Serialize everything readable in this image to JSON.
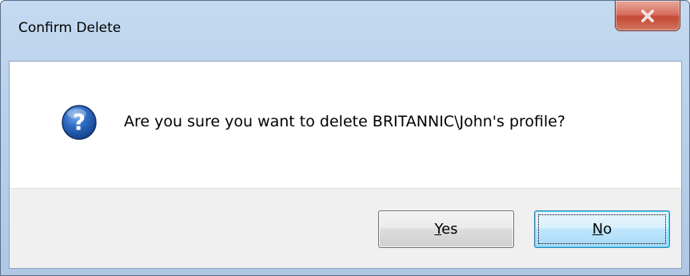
{
  "window": {
    "title": "Confirm Delete"
  },
  "dialog": {
    "icon": "question-icon",
    "message": "Are you sure you want to delete BRITANNIC\\John's profile?"
  },
  "buttons": {
    "yes_label": "Yes",
    "no_label": "No",
    "default": "No"
  },
  "colors": {
    "close_button": "#c44a34",
    "question_icon": "#2659a8",
    "default_button_border": "#3c7fb1",
    "button_area": "#f0f0f0"
  }
}
